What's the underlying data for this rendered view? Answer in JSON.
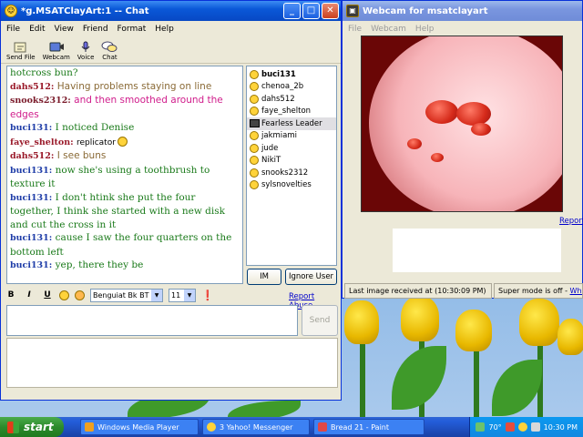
{
  "chat": {
    "title": "*g.MSATClayArt:1 -- Chat",
    "menu": [
      "File",
      "Edit",
      "View",
      "Friend",
      "Format",
      "Help"
    ],
    "toolbar": [
      "Send File",
      "Webcam",
      "Voice",
      "Chat"
    ],
    "messages": [
      {
        "who": "",
        "cls": "first",
        "text": "hotcross bun?"
      },
      {
        "who": "dahs512:",
        "cls": "dahs",
        "text": "Having problems staying on line"
      },
      {
        "who": "snooks2312:",
        "cls": "snooks",
        "text": "and then smoothed around the edges"
      },
      {
        "who": "buci131:",
        "cls": "buci",
        "text": "I noticed Denise"
      },
      {
        "who": "faye_shelton:",
        "cls": "faye",
        "text": "replicator"
      },
      {
        "who": "dahs512:",
        "cls": "dahs",
        "text": "I see buns"
      },
      {
        "who": "buci131:",
        "cls": "buci",
        "text": "now she's using a toothbrush to texture it"
      },
      {
        "who": "buci131:",
        "cls": "buci",
        "text": "I don't htink she put the four together, I think she started with a new disk and cut the cross in it"
      },
      {
        "who": "buci131:",
        "cls": "buci",
        "text": "cause I saw the four quarters on the bottom left"
      },
      {
        "who": "buci131:",
        "cls": "buci",
        "text": "yep, there they be"
      }
    ],
    "users": [
      {
        "name": "buci131",
        "bold": true,
        "cam": false
      },
      {
        "name": "chenoa_2b",
        "bold": false,
        "cam": false
      },
      {
        "name": "dahs512",
        "bold": false,
        "cam": false
      },
      {
        "name": "faye_shelton",
        "bold": false,
        "cam": false
      },
      {
        "name": "Fearless Leader",
        "bold": false,
        "cam": true,
        "selected": true
      },
      {
        "name": "jakmiami",
        "bold": false,
        "cam": false
      },
      {
        "name": "jude",
        "bold": false,
        "cam": false
      },
      {
        "name": "NikiT",
        "bold": false,
        "cam": false
      },
      {
        "name": "snooks2312",
        "bold": false,
        "cam": false
      },
      {
        "name": "sylsnovelties",
        "bold": false,
        "cam": false
      }
    ],
    "im_label": "IM",
    "ignore_label": "Ignore User",
    "format": {
      "bold": "B",
      "italic": "I",
      "underline": "U",
      "font": "Benguiat Bk BT",
      "size": "11"
    },
    "report_abuse": "Report Abuse",
    "send_label": "Send"
  },
  "webcam": {
    "title": "Webcam for msatclayart",
    "menu": [
      "File",
      "Webcam",
      "Help"
    ],
    "report": "Report",
    "status_left": "Last image received at (10:30:09 PM)",
    "status_right_prefix": "Super mode is off - ",
    "status_right_link": "What's this?"
  },
  "taskbar": {
    "start": "start",
    "tasks": [
      {
        "label": "Windows Media Player",
        "color": "#f0a020"
      },
      {
        "label": "3 Yahoo! Messenger",
        "color": "#ffd33a"
      },
      {
        "label": "Bread 21 - Paint",
        "color": "#e04848"
      }
    ],
    "temp": "70°",
    "clock": "10:30 PM"
  }
}
